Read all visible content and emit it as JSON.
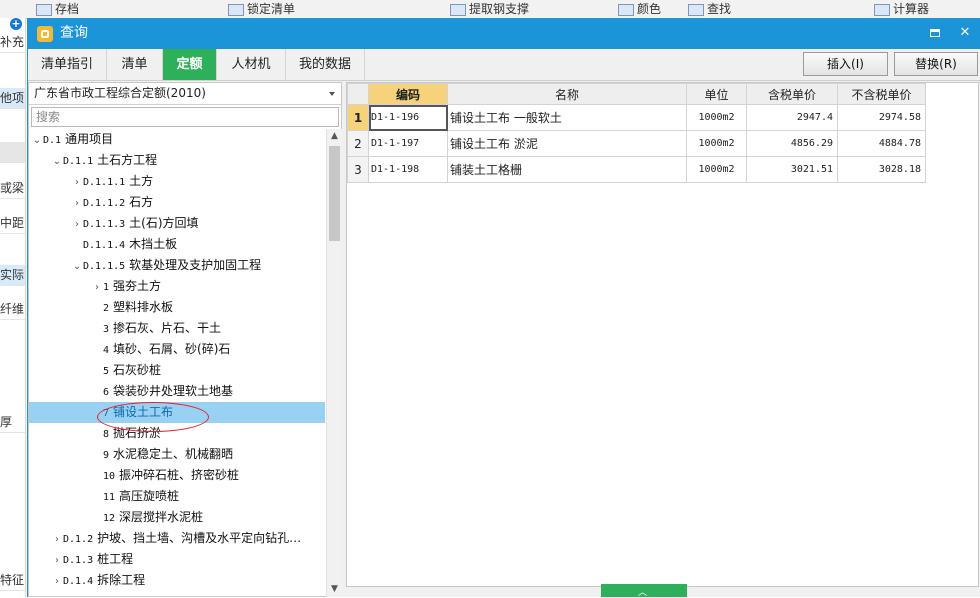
{
  "background_app": {
    "toolbar": {
      "archive_label": "存档",
      "lock_label": "锁定清单",
      "extract_label": "提取钢支撑",
      "color_label": "颜色",
      "find_label": "查找",
      "calc_label": "计算器"
    },
    "left_fragments": [
      "补充",
      "他项",
      "或梁",
      "中距",
      "实际",
      "纤维",
      "厚",
      "特征"
    ]
  },
  "dialog": {
    "title": "查询",
    "icons": {
      "logo": "app-logo-icon",
      "restore": "restore-window-icon",
      "close": "close-icon"
    },
    "close_glyph": "✕",
    "tabs": [
      {
        "label": "清单指引"
      },
      {
        "label": "清单"
      },
      {
        "label": "定额"
      },
      {
        "label": "人材机"
      },
      {
        "label": "我的数据"
      }
    ],
    "active_tab": "定额",
    "insert_label": "插入(I)",
    "replace_label": "替换(R)",
    "accent_color": "#2eb05a",
    "titlebar_color": "#1c95d8"
  },
  "left": {
    "quota_select": "广东省市政工程综合定额(2010)",
    "search_placeholder": "搜索",
    "tree": [
      {
        "chev": "⌄",
        "code": "D.1",
        "label": "通用项目"
      },
      {
        "chev": "⌄",
        "code": "D.1.1",
        "label": "土石方工程"
      },
      {
        "chev": "›",
        "code": "D.1.1.1",
        "label": "土方"
      },
      {
        "chev": "›",
        "code": "D.1.1.2",
        "label": "石方"
      },
      {
        "chev": "›",
        "code": "D.1.1.3",
        "label": "土(石)方回填"
      },
      {
        "chev": "",
        "code": "D.1.1.4",
        "label": "木挡土板"
      },
      {
        "chev": "⌄",
        "code": "D.1.1.5",
        "label": "软基处理及支护加固工程"
      },
      {
        "chev": "›",
        "code": "1",
        "label": "强夯土方"
      },
      {
        "chev": "",
        "code": "2",
        "label": "塑料排水板"
      },
      {
        "chev": "",
        "code": "3",
        "label": "掺石灰、片石、干土"
      },
      {
        "chev": "",
        "code": "4",
        "label": "填砂、石屑、砂(碎)石"
      },
      {
        "chev": "",
        "code": "5",
        "label": "石灰砂桩"
      },
      {
        "chev": "",
        "code": "6",
        "label": "袋装砂井处理软土地基"
      },
      {
        "chev": "",
        "code": "7",
        "label": "铺设土工布"
      },
      {
        "chev": "",
        "code": "8",
        "label": "抛石挤淤"
      },
      {
        "chev": "",
        "code": "9",
        "label": "水泥稳定土、机械翻晒"
      },
      {
        "chev": "",
        "code": "10",
        "label": "振冲碎石桩、挤密砂桩"
      },
      {
        "chev": "",
        "code": "11",
        "label": "高压旋喷桩"
      },
      {
        "chev": "",
        "code": "12",
        "label": "深层搅拌水泥桩"
      },
      {
        "chev": "›",
        "code": "D.1.2",
        "label": "护坡、挡土墙、沟槽及水平定向钻孔…"
      },
      {
        "chev": "›",
        "code": "D.1.3",
        "label": "桩工程"
      },
      {
        "chev": "›",
        "code": "D.1.4",
        "label": "拆除工程"
      }
    ],
    "selected_node": "7 铺设土工布",
    "scroll_icons": {
      "up": "scroll-up-icon",
      "down": "scroll-down-icon"
    }
  },
  "table": {
    "columns": [
      "编码",
      "名称",
      "单位",
      "含税单价",
      "不含税单价"
    ],
    "rows": [
      {
        "no": "1",
        "code": "D1-1-196",
        "name": "铺设土工布 一般软土",
        "unit": "1000m2",
        "price_tax": "2947.4",
        "price_notax": "2974.58"
      },
      {
        "no": "2",
        "code": "D1-1-197",
        "name": "铺设土工布 淤泥",
        "unit": "1000m2",
        "price_tax": "4856.29",
        "price_notax": "4884.78"
      },
      {
        "no": "3",
        "code": "D1-1-198",
        "name": "铺装土工格栅",
        "unit": "1000m2",
        "price_tax": "3021.51",
        "price_notax": "3028.18"
      }
    ]
  }
}
